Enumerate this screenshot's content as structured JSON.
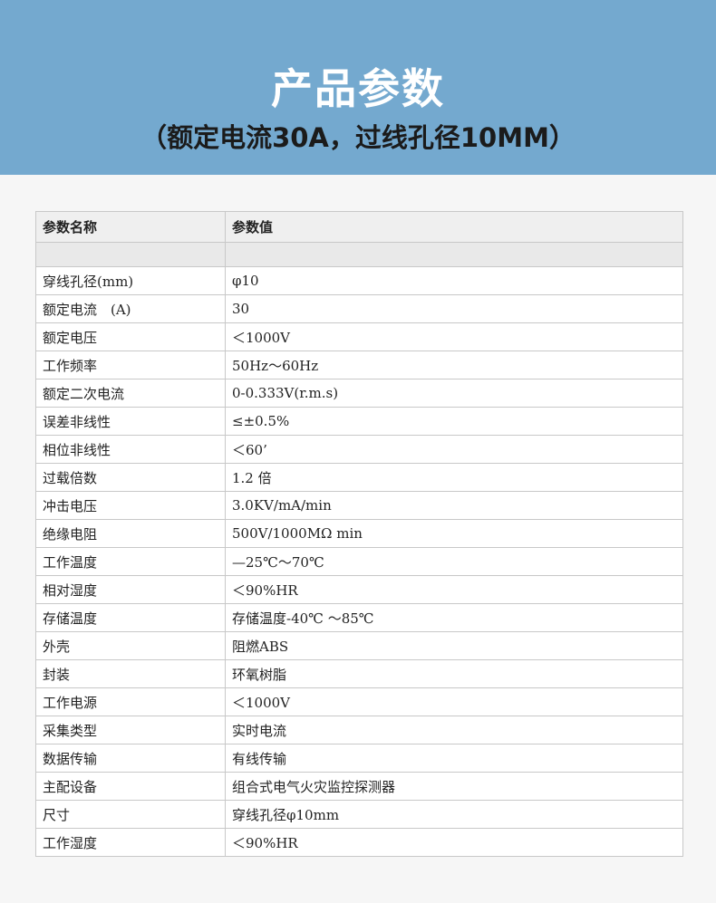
{
  "banner": {
    "title": "产品参数",
    "subtitle": "（额定电流30A，过线孔径10MM）",
    "background_color": "#74a9cf"
  },
  "table": {
    "headers": [
      "参数名称",
      "参数值"
    ],
    "rows": [
      [
        "穿线孔径(mm)",
        "φ10"
      ],
      [
        "额定电流　(A)",
        "30"
      ],
      [
        "额定电压",
        "＜1000V"
      ],
      [
        "工作频率",
        "50Hz～60Hz"
      ],
      [
        "额定二次电流",
        "0-0.333V(r.m.s)"
      ],
      [
        "误差非线性",
        "≤±0.5%"
      ],
      [
        "相位非线性",
        "＜60’"
      ],
      [
        "过载倍数",
        "1.2 倍"
      ],
      [
        "冲击电压",
        "3.0KV/mA/min"
      ],
      [
        "绝缘电阻",
        "500V/1000MΩ min"
      ],
      [
        "工作温度",
        "—25℃～70℃"
      ],
      [
        "相对湿度",
        "＜90%HR"
      ],
      [
        "存储温度",
        "存储温度-40℃ ～85℃"
      ],
      [
        "外壳",
        "阻燃ABS"
      ],
      [
        "封装",
        "环氧树脂"
      ],
      [
        "工作电源",
        "＜1000V"
      ],
      [
        "采集类型",
        "实时电流"
      ],
      [
        "数据传输",
        "有线传输"
      ],
      [
        "主配设备",
        "组合式电气火灾监控探测器"
      ],
      [
        "尺寸",
        "穿线孔径φ10mm"
      ],
      [
        "工作湿度",
        "＜90%HR"
      ]
    ]
  }
}
